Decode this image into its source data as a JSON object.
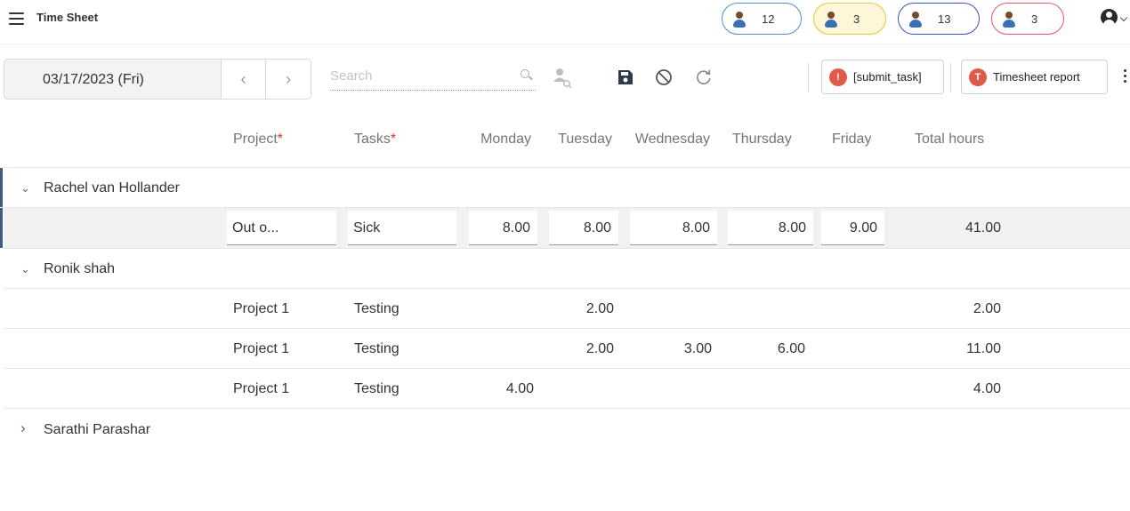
{
  "app": {
    "title": "Time Sheet"
  },
  "badges": [
    {
      "count": "12",
      "color": "#4a90d9"
    },
    {
      "count": "3",
      "color": "#e8c53a"
    },
    {
      "count": "13",
      "color": "#3b4fc7"
    },
    {
      "count": "3",
      "color": "#e05a6a"
    }
  ],
  "toolbar": {
    "date": "03/17/2023 (Fri)",
    "prev": "‹",
    "next": "›",
    "search_placeholder": "Search",
    "submit_task": {
      "icon": "!",
      "label": "[submit_task]"
    },
    "timesheet_report": {
      "icon": "T",
      "label": "Timesheet report"
    }
  },
  "columns": {
    "project": "Project",
    "tasks": "Tasks",
    "required_mark": "*",
    "monday": "Monday",
    "tuesday": "Tuesday",
    "wednesday": "Wednesday",
    "thursday": "Thursday",
    "friday": "Friday",
    "total": "Total hours"
  },
  "groups": [
    {
      "name": "Rachel van Hollander",
      "chevron": "⌄",
      "rows": [
        {
          "project": "Out o...",
          "task": "Sick",
          "monday": "8.00",
          "tuesday": "8.00",
          "wednesday": "8.00",
          "thursday": "8.00",
          "friday": "9.00",
          "total": "41.00"
        }
      ]
    },
    {
      "name": "Ronik shah",
      "chevron": "⌄",
      "rows": [
        {
          "project": "Project 1",
          "task": "Testing",
          "monday": "",
          "tuesday": "2.00",
          "wednesday": "",
          "thursday": "",
          "friday": "",
          "total": "2.00"
        },
        {
          "project": "Project 1",
          "task": "Testing",
          "monday": "",
          "tuesday": "2.00",
          "wednesday": "3.00",
          "thursday": "6.00",
          "friday": "",
          "total": "11.00"
        },
        {
          "project": "Project 1",
          "task": "Testing",
          "monday": "4.00",
          "tuesday": "",
          "wednesday": "",
          "thursday": "",
          "friday": "",
          "total": "4.00"
        }
      ]
    },
    {
      "name": "Sarathi Parashar",
      "chevron": "›"
    }
  ]
}
